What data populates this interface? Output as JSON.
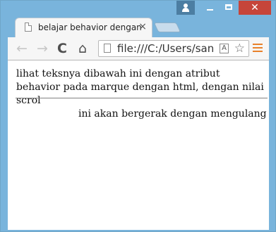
{
  "browser": {
    "tab_title": "belajar behavior dengan m",
    "tab_close": "×",
    "close_glyph": "✕",
    "url": "file:///C:/Users/san",
    "accent_color": "#79b4dc",
    "close_color": "#c6453a"
  },
  "toolbar": {
    "back_icon": "←",
    "forward_icon": "→",
    "reload_icon": "C",
    "home_icon": "⌂",
    "star_icon": "☆"
  },
  "page": {
    "intro": "lihat teksnya dibawah ini dengan atribut behavior pada marque dengan html, dengan nilai scrol",
    "marquee_text": "ini akan bergerak dengan mengulang ke"
  }
}
